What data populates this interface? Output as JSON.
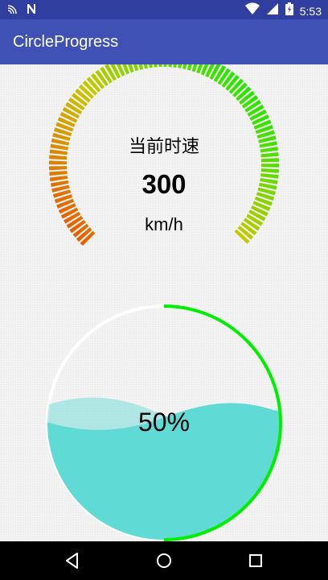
{
  "status_bar": {
    "time": "5:53",
    "left_icons": [
      "cast-icon",
      "n-notification-icon"
    ],
    "right_icons": [
      "wifi-icon",
      "cell-signal-icon",
      "battery-icon"
    ]
  },
  "app_bar": {
    "title": "CircleProgress"
  },
  "speed_dial": {
    "title": "当前时速",
    "value": "300",
    "unit": "km/h",
    "gradient_colors": [
      "#22e600",
      "#c8c800",
      "#e85a00"
    ]
  },
  "wave_progress": {
    "label": "50%",
    "value_fraction": 0.5,
    "arc_color": "#00ee00",
    "water_color": "#5fdad5"
  },
  "nav_bar": {
    "buttons": [
      "back-icon",
      "home-icon",
      "recents-icon"
    ]
  }
}
